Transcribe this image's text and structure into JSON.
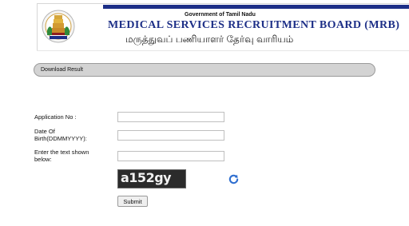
{
  "header": {
    "government": "Government of Tamil Nadu",
    "board_name_en": "MEDICAL SERVICES RECRUITMENT BOARD (MRB)",
    "board_name_ta": "மருத்துவப் பணியாளர் தேர்வு வாரியம்"
  },
  "section": {
    "title": "Download Result"
  },
  "form": {
    "application_no_label": "Application No :",
    "application_no_value": "",
    "dob_label_1": "Date Of",
    "dob_label_2": "Birth(DDMMYYYY):",
    "dob_value": "",
    "captcha_label_1": "Enter the text shown",
    "captcha_label_2": "below:",
    "captcha_value": "",
    "captcha_text": "a152gy",
    "submit_label": "Submit"
  },
  "icons": {
    "refresh": "refresh-icon",
    "logo": "tamil-nadu-emblem"
  },
  "colors": {
    "brand": "#1d2f87",
    "bar": "#d3d3d3"
  }
}
